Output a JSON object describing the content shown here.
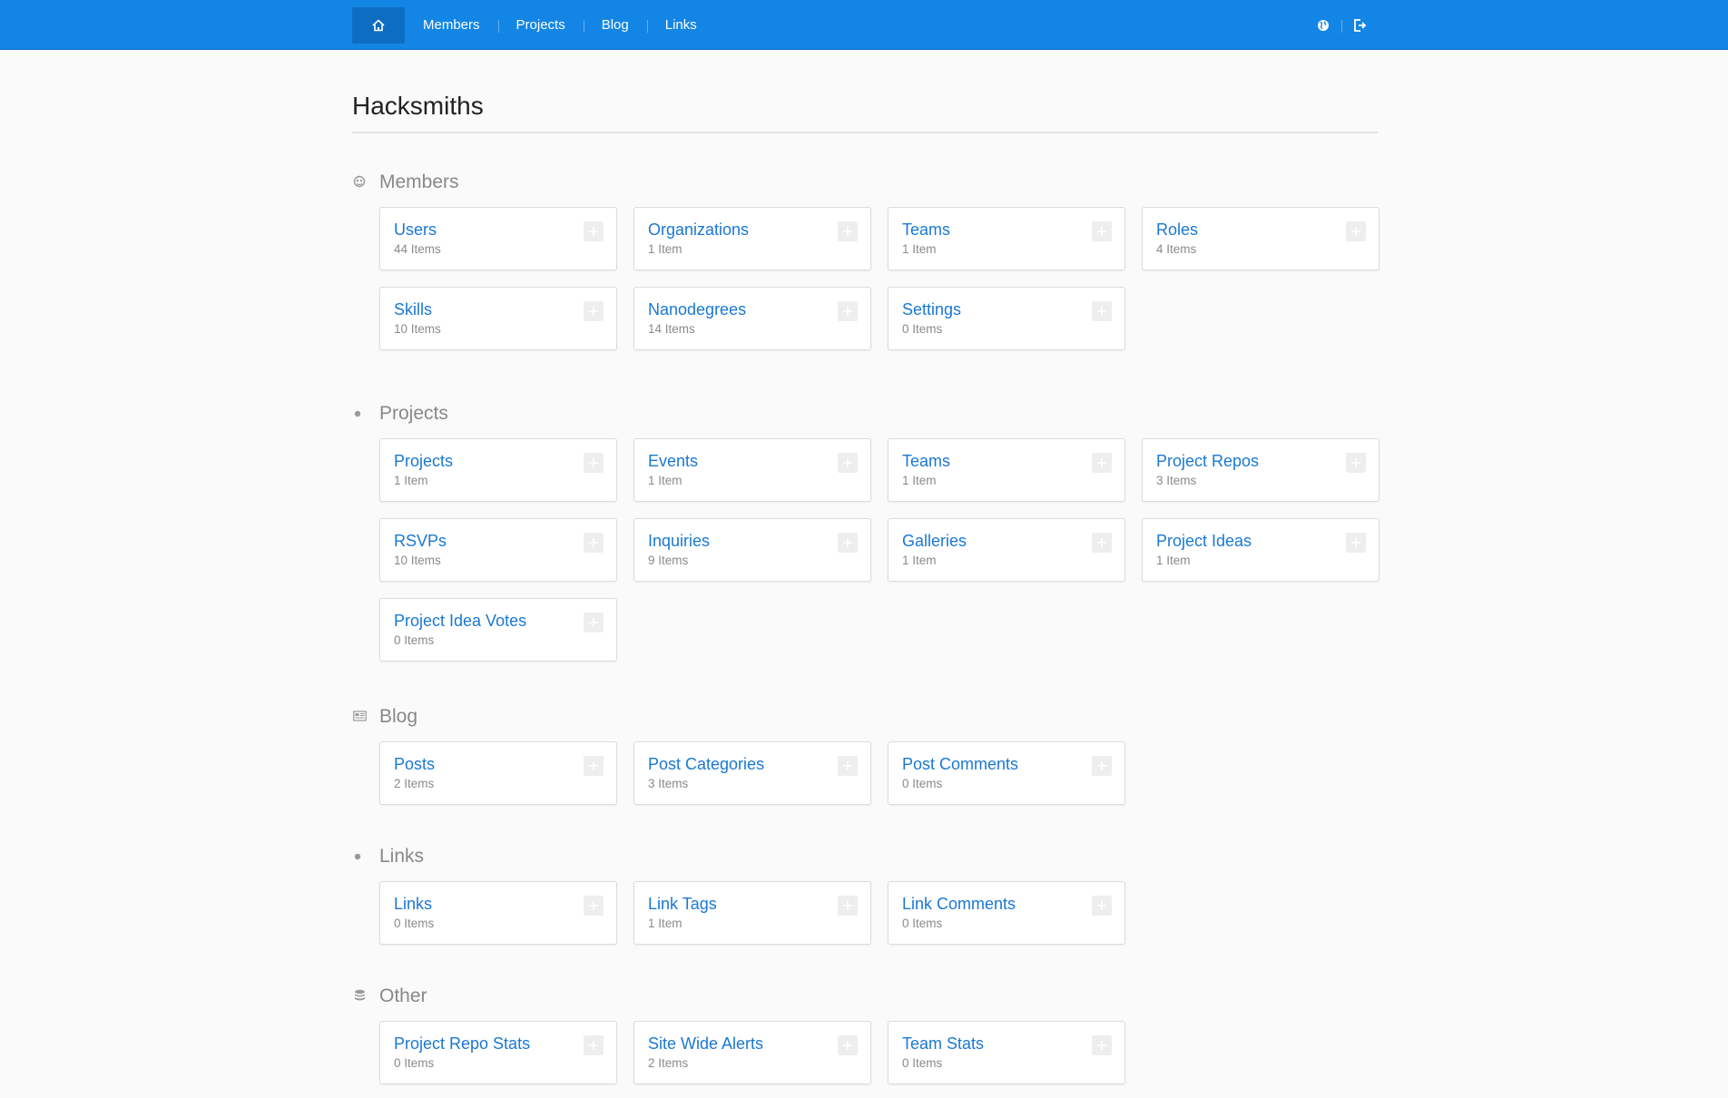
{
  "topbar": {
    "home_icon": "home-icon",
    "nav": [
      {
        "label": "Members"
      },
      {
        "label": "Projects"
      },
      {
        "label": "Blog"
      },
      {
        "label": "Links"
      }
    ],
    "right_icons": [
      "globe-icon",
      "sign-out-icon"
    ],
    "color": "#1385e5"
  },
  "page": {
    "title": "Hacksmiths"
  },
  "sections": [
    {
      "title": "Members",
      "icon": "users-icon",
      "tiles": [
        {
          "name": "Users",
          "count": "44 Items"
        },
        {
          "name": "Organizations",
          "count": "1 Item"
        },
        {
          "name": "Teams",
          "count": "1 Item"
        },
        {
          "name": "Roles",
          "count": "4 Items"
        },
        {
          "name": "Skills",
          "count": "10 Items"
        },
        {
          "name": "Nanodegrees",
          "count": "14 Items"
        },
        {
          "name": "Settings",
          "count": "0 Items"
        }
      ]
    },
    {
      "title": "Projects",
      "icon": "dot-icon",
      "tiles": [
        {
          "name": "Projects",
          "count": "1 Item"
        },
        {
          "name": "Events",
          "count": "1 Item"
        },
        {
          "name": "Teams",
          "count": "1 Item"
        },
        {
          "name": "Project Repos",
          "count": "3 Items"
        },
        {
          "name": "RSVPs",
          "count": "10 Items"
        },
        {
          "name": "Inquiries",
          "count": "9 Items"
        },
        {
          "name": "Galleries",
          "count": "1 Item"
        },
        {
          "name": "Project Ideas",
          "count": "1 Item"
        },
        {
          "name": "Project Idea Votes",
          "count": "0 Items"
        }
      ]
    },
    {
      "title": "Blog",
      "icon": "newspaper-icon",
      "tiles": [
        {
          "name": "Posts",
          "count": "2 Items"
        },
        {
          "name": "Post Categories",
          "count": "3 Items"
        },
        {
          "name": "Post Comments",
          "count": "0 Items"
        }
      ]
    },
    {
      "title": "Links",
      "icon": "dot-icon",
      "tiles": [
        {
          "name": "Links",
          "count": "0 Items"
        },
        {
          "name": "Link Tags",
          "count": "1 Item"
        },
        {
          "name": "Link Comments",
          "count": "0 Items"
        }
      ]
    },
    {
      "title": "Other",
      "icon": "database-icon",
      "tiles": [
        {
          "name": "Project Repo Stats",
          "count": "0 Items"
        },
        {
          "name": "Site Wide Alerts",
          "count": "2 Items"
        },
        {
          "name": "Team Stats",
          "count": "0 Items"
        }
      ]
    }
  ]
}
